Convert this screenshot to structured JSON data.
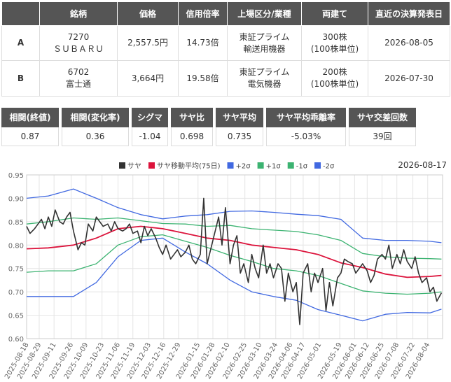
{
  "pair_table": {
    "headers": [
      "",
      "銘柄",
      "価格",
      "信用倍率",
      "上場区分/業種",
      "両建て",
      "直近の決算発表日"
    ],
    "rows": [
      {
        "label": "A",
        "code": "7270",
        "name": "ＳＵＢＡＲＵ",
        "price": "2,557.5円",
        "margin_ratio": "14.73倍",
        "market": "東証プライム",
        "industry": "輸送用機器",
        "shares": "300株",
        "unit": "(100株単位)",
        "earnings_date": "2026-08-05"
      },
      {
        "label": "B",
        "code": "6702",
        "name": "富士通",
        "price": "3,664円",
        "margin_ratio": "19.58倍",
        "market": "東証プライム",
        "industry": "電気機器",
        "shares": "200株",
        "unit": "(100株単位)",
        "earnings_date": "2026-07-30"
      }
    ]
  },
  "stats": [
    {
      "label": "相関(終値)",
      "value": "0.87"
    },
    {
      "label": "相関(変化率)",
      "value": "0.36"
    },
    {
      "label": "シグマ",
      "value": "-1.04"
    },
    {
      "label": "サヤ比",
      "value": "0.698"
    },
    {
      "label": "サヤ平均",
      "value": "0.735"
    },
    {
      "label": "サヤ平均乖離率",
      "value": "-5.03%"
    },
    {
      "label": "サヤ交差回数",
      "value": "39回"
    }
  ],
  "chart_data": {
    "type": "line",
    "date_label": "2026-08-17",
    "ylim": [
      0.6,
      0.95
    ],
    "yticks": [
      "0.60",
      "0.65",
      "0.70",
      "0.75",
      "0.80",
      "0.85",
      "0.90",
      "0.95"
    ],
    "x_start": "2025-08-18",
    "x_end": "2026-08-17",
    "xticks": [
      "2025-08-18",
      "2025-08-29",
      "2025-09-11",
      "2025-09-26",
      "2025-10-09",
      "2025-10-23",
      "2025-11-06",
      "2025-11-19",
      "2025-12-03",
      "2025-12-16",
      "2025-12-29",
      "2026-01-15",
      "2026-01-28",
      "2026-02-10",
      "2026-02-25",
      "2026-03-10",
      "2026-03-24",
      "2026-04-06",
      "2026-04-17",
      "2026-05-01",
      "2026-05-19",
      "2026-06-01",
      "2026-06-12",
      "2026-06-25",
      "2026-07-08",
      "2026-07-22",
      "2026-08-04"
    ],
    "series": [
      {
        "name": "サヤ",
        "color": "#333333",
        "width": 1.6,
        "x": [
          "2025-08-18",
          "2025-08-21",
          "2025-08-25",
          "2025-08-28",
          "2025-08-31",
          "2025-09-03",
          "2025-09-06",
          "2025-09-09",
          "2025-09-12",
          "2025-09-16",
          "2025-09-19",
          "2025-09-22",
          "2025-09-25",
          "2025-09-28",
          "2025-10-02",
          "2025-10-05",
          "2025-10-08",
          "2025-10-11",
          "2025-10-15",
          "2025-10-18",
          "2025-10-21",
          "2025-10-24",
          "2025-10-28",
          "2025-10-31",
          "2025-11-03",
          "2025-11-06",
          "2025-11-10",
          "2025-11-13",
          "2025-11-16",
          "2025-11-19",
          "2025-11-23",
          "2025-11-26",
          "2025-11-29",
          "2025-12-02",
          "2025-12-05",
          "2025-12-09",
          "2025-12-12",
          "2025-12-15",
          "2025-12-18",
          "2025-12-22",
          "2025-12-25",
          "2025-12-28",
          "2025-12-31",
          "2026-01-04",
          "2026-01-07",
          "2026-01-10",
          "2026-01-13",
          "2026-01-17",
          "2026-01-20",
          "2026-01-23",
          "2026-01-26",
          "2026-01-30",
          "2026-02-02",
          "2026-02-05",
          "2026-02-08",
          "2026-02-12",
          "2026-02-15",
          "2026-02-18",
          "2026-02-21",
          "2026-02-24",
          "2026-02-28",
          "2026-03-03",
          "2026-03-06",
          "2026-03-09",
          "2026-03-13",
          "2026-03-16",
          "2026-03-19",
          "2026-03-22",
          "2026-03-26",
          "2026-03-29",
          "2026-04-01",
          "2026-04-04",
          "2026-04-08",
          "2026-04-11",
          "2026-04-14",
          "2026-04-17",
          "2026-04-21",
          "2026-04-24",
          "2026-04-27",
          "2026-04-30",
          "2026-05-04",
          "2026-05-07",
          "2026-05-10",
          "2026-05-13",
          "2026-05-17",
          "2026-05-20",
          "2026-05-23",
          "2026-05-26",
          "2026-05-30",
          "2026-06-02",
          "2026-06-05",
          "2026-06-08",
          "2026-06-12",
          "2026-06-15",
          "2026-06-18",
          "2026-06-21",
          "2026-06-25",
          "2026-06-28",
          "2026-07-01",
          "2026-07-04",
          "2026-07-08",
          "2026-07-11",
          "2026-07-14",
          "2026-07-17",
          "2026-07-21",
          "2026-07-24",
          "2026-07-27",
          "2026-07-30",
          "2026-08-03",
          "2026-08-06",
          "2026-08-09",
          "2026-08-12",
          "2026-08-16"
        ],
        "y": [
          0.84,
          0.825,
          0.835,
          0.845,
          0.855,
          0.835,
          0.86,
          0.84,
          0.875,
          0.85,
          0.845,
          0.86,
          0.87,
          0.83,
          0.79,
          0.805,
          0.8,
          0.845,
          0.83,
          0.86,
          0.85,
          0.84,
          0.845,
          0.83,
          0.85,
          0.835,
          0.83,
          0.835,
          0.845,
          0.825,
          0.83,
          0.805,
          0.84,
          0.82,
          0.835,
          0.815,
          0.795,
          0.78,
          0.8,
          0.77,
          0.78,
          0.79,
          0.775,
          0.785,
          0.8,
          0.77,
          0.76,
          0.78,
          0.9,
          0.76,
          0.79,
          0.83,
          0.86,
          0.8,
          0.88,
          0.76,
          0.8,
          0.82,
          0.74,
          0.76,
          0.72,
          0.78,
          0.75,
          0.73,
          0.8,
          0.74,
          0.76,
          0.73,
          0.76,
          0.75,
          0.68,
          0.74,
          0.7,
          0.72,
          0.63,
          0.74,
          0.76,
          0.7,
          0.74,
          0.72,
          0.75,
          0.66,
          0.72,
          0.67,
          0.73,
          0.74,
          0.77,
          0.765,
          0.76,
          0.74,
          0.75,
          0.76,
          0.745,
          0.72,
          0.735,
          0.77,
          0.78,
          0.77,
          0.8,
          0.75,
          0.78,
          0.76,
          0.79,
          0.765,
          0.75,
          0.775,
          0.74,
          0.72,
          0.73,
          0.7,
          0.71,
          0.68,
          0.698
        ]
      },
      {
        "name": "サヤ移動平均(75日)",
        "color": "#dc143c",
        "width": 1.8,
        "x": [
          "2025-08-18",
          "2025-09-06",
          "2025-09-28",
          "2025-10-18",
          "2025-11-06",
          "2025-11-26",
          "2025-12-15",
          "2026-01-04",
          "2026-01-23",
          "2026-02-12",
          "2026-03-03",
          "2026-03-22",
          "2026-04-11",
          "2026-04-30",
          "2026-05-20",
          "2026-06-08",
          "2026-06-28",
          "2026-07-17",
          "2026-08-06",
          "2026-08-16"
        ],
        "y": [
          0.792,
          0.794,
          0.8,
          0.815,
          0.835,
          0.84,
          0.835,
          0.825,
          0.815,
          0.81,
          0.8,
          0.795,
          0.79,
          0.78,
          0.762,
          0.752,
          0.738,
          0.731,
          0.733,
          0.735
        ]
      },
      {
        "name": "+2σ",
        "color": "#4169e1",
        "width": 1.3,
        "x": [
          "2025-08-18",
          "2025-09-06",
          "2025-09-28",
          "2025-10-18",
          "2025-11-06",
          "2025-11-26",
          "2025-12-15",
          "2026-01-04",
          "2026-01-23",
          "2026-02-12",
          "2026-03-03",
          "2026-03-22",
          "2026-04-11",
          "2026-04-30",
          "2026-05-20",
          "2026-06-08",
          "2026-06-28",
          "2026-07-17",
          "2026-08-06",
          "2026-08-16"
        ],
        "y": [
          0.9,
          0.905,
          0.92,
          0.9,
          0.88,
          0.865,
          0.856,
          0.862,
          0.865,
          0.872,
          0.873,
          0.87,
          0.866,
          0.863,
          0.855,
          0.815,
          0.81,
          0.81,
          0.808,
          0.805
        ]
      },
      {
        "name": "+1σ",
        "color": "#3cb371",
        "width": 1.3,
        "x": [
          "2025-08-18",
          "2025-09-06",
          "2025-09-28",
          "2025-10-18",
          "2025-11-06",
          "2025-11-26",
          "2025-12-15",
          "2026-01-04",
          "2026-01-23",
          "2026-02-12",
          "2026-03-03",
          "2026-03-22",
          "2026-04-11",
          "2026-04-30",
          "2026-05-20",
          "2026-06-08",
          "2026-06-28",
          "2026-07-17",
          "2026-08-06",
          "2026-08-16"
        ],
        "y": [
          0.845,
          0.85,
          0.858,
          0.855,
          0.858,
          0.852,
          0.846,
          0.845,
          0.84,
          0.842,
          0.835,
          0.832,
          0.829,
          0.822,
          0.81,
          0.782,
          0.775,
          0.772,
          0.771,
          0.77
        ]
      },
      {
        "name": "-1σ",
        "color": "#3cb371",
        "width": 1.3,
        "x": [
          "2025-08-18",
          "2025-09-06",
          "2025-09-28",
          "2025-10-18",
          "2025-11-06",
          "2025-11-26",
          "2025-12-15",
          "2026-01-04",
          "2026-01-23",
          "2026-02-12",
          "2026-03-03",
          "2026-03-22",
          "2026-04-11",
          "2026-04-30",
          "2026-05-20",
          "2026-06-08",
          "2026-06-28",
          "2026-07-17",
          "2026-08-06",
          "2026-08-16"
        ],
        "y": [
          0.742,
          0.745,
          0.745,
          0.76,
          0.8,
          0.818,
          0.822,
          0.808,
          0.795,
          0.778,
          0.765,
          0.75,
          0.745,
          0.735,
          0.718,
          0.702,
          0.697,
          0.695,
          0.697,
          0.7
        ]
      },
      {
        "name": "-2σ",
        "color": "#4169e1",
        "width": 1.3,
        "x": [
          "2025-08-18",
          "2025-09-06",
          "2025-09-28",
          "2025-10-18",
          "2025-11-06",
          "2025-11-26",
          "2025-12-15",
          "2026-01-04",
          "2026-01-23",
          "2026-02-12",
          "2026-03-03",
          "2026-03-22",
          "2026-04-11",
          "2026-04-30",
          "2026-05-20",
          "2026-06-08",
          "2026-06-28",
          "2026-07-17",
          "2026-08-06",
          "2026-08-16"
        ],
        "y": [
          0.69,
          0.69,
          0.69,
          0.72,
          0.775,
          0.81,
          0.815,
          0.785,
          0.76,
          0.725,
          0.7,
          0.69,
          0.682,
          0.662,
          0.65,
          0.638,
          0.652,
          0.656,
          0.655,
          0.663
        ]
      }
    ]
  }
}
